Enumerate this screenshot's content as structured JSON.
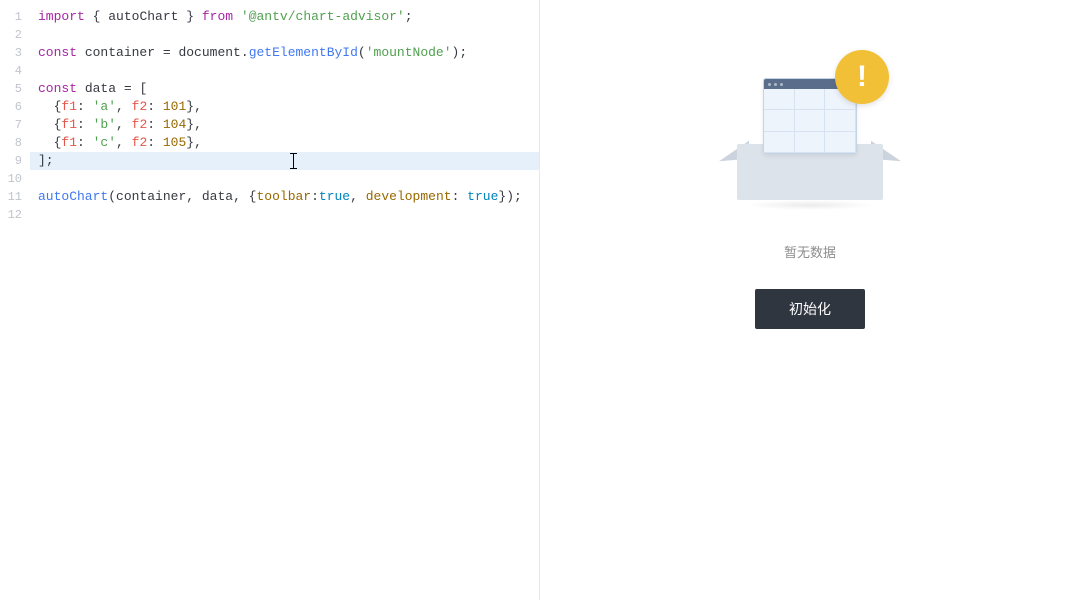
{
  "editor": {
    "highlighted_line_index": 8,
    "cursor": {
      "line": 9,
      "col_approx": 36
    },
    "line_numbers": [
      "1",
      "2",
      "3",
      "4",
      "5",
      "6",
      "7",
      "8",
      "9",
      "10",
      "11",
      "12"
    ],
    "lines": [
      {
        "tokens": [
          {
            "t": "import",
            "c": "kw"
          },
          {
            "t": " ",
            "c": "punc"
          },
          {
            "t": "{ ",
            "c": "punc"
          },
          {
            "t": "autoChart",
            "c": "var"
          },
          {
            "t": " }",
            "c": "punc"
          },
          {
            "t": " ",
            "c": "punc"
          },
          {
            "t": "from",
            "c": "kw"
          },
          {
            "t": " ",
            "c": "punc"
          },
          {
            "t": "'@antv/chart-advisor'",
            "c": "str"
          },
          {
            "t": ";",
            "c": "punc"
          }
        ]
      },
      {
        "tokens": []
      },
      {
        "tokens": [
          {
            "t": "const",
            "c": "kw"
          },
          {
            "t": " ",
            "c": "punc"
          },
          {
            "t": "container",
            "c": "var"
          },
          {
            "t": " = ",
            "c": "punc"
          },
          {
            "t": "document",
            "c": "obj"
          },
          {
            "t": ".",
            "c": "punc"
          },
          {
            "t": "getElementById",
            "c": "fn"
          },
          {
            "t": "(",
            "c": "punc"
          },
          {
            "t": "'mountNode'",
            "c": "str"
          },
          {
            "t": ");",
            "c": "punc"
          }
        ]
      },
      {
        "tokens": []
      },
      {
        "tokens": [
          {
            "t": "const",
            "c": "kw"
          },
          {
            "t": " ",
            "c": "punc"
          },
          {
            "t": "data",
            "c": "var"
          },
          {
            "t": " = [",
            "c": "punc"
          }
        ]
      },
      {
        "tokens": [
          {
            "t": "  {",
            "c": "punc"
          },
          {
            "t": "f1",
            "c": "prop"
          },
          {
            "t": ": ",
            "c": "punc"
          },
          {
            "t": "'a'",
            "c": "str"
          },
          {
            "t": ", ",
            "c": "punc"
          },
          {
            "t": "f2",
            "c": "prop"
          },
          {
            "t": ": ",
            "c": "punc"
          },
          {
            "t": "101",
            "c": "num"
          },
          {
            "t": "},",
            "c": "punc"
          }
        ]
      },
      {
        "tokens": [
          {
            "t": "  {",
            "c": "punc"
          },
          {
            "t": "f1",
            "c": "prop"
          },
          {
            "t": ": ",
            "c": "punc"
          },
          {
            "t": "'b'",
            "c": "str"
          },
          {
            "t": ", ",
            "c": "punc"
          },
          {
            "t": "f2",
            "c": "prop"
          },
          {
            "t": ": ",
            "c": "punc"
          },
          {
            "t": "104",
            "c": "num"
          },
          {
            "t": "},",
            "c": "punc"
          }
        ]
      },
      {
        "tokens": [
          {
            "t": "  {",
            "c": "punc"
          },
          {
            "t": "f1",
            "c": "prop"
          },
          {
            "t": ": ",
            "c": "punc"
          },
          {
            "t": "'c'",
            "c": "str"
          },
          {
            "t": ", ",
            "c": "punc"
          },
          {
            "t": "f2",
            "c": "prop"
          },
          {
            "t": ": ",
            "c": "punc"
          },
          {
            "t": "105",
            "c": "num"
          },
          {
            "t": "},",
            "c": "punc"
          }
        ]
      },
      {
        "tokens": [
          {
            "t": "];",
            "c": "punc"
          }
        ]
      },
      {
        "tokens": []
      },
      {
        "tokens": [
          {
            "t": "autoChart",
            "c": "fn"
          },
          {
            "t": "(",
            "c": "punc"
          },
          {
            "t": "container",
            "c": "var"
          },
          {
            "t": ", ",
            "c": "punc"
          },
          {
            "t": "data",
            "c": "var"
          },
          {
            "t": ", {",
            "c": "punc"
          },
          {
            "t": "toolbar",
            "c": "attr"
          },
          {
            "t": ":",
            "c": "punc"
          },
          {
            "t": "true",
            "c": "bool"
          },
          {
            "t": ", ",
            "c": "punc"
          },
          {
            "t": "development",
            "c": "attr"
          },
          {
            "t": ": ",
            "c": "punc"
          },
          {
            "t": "true",
            "c": "bool"
          },
          {
            "t": "});",
            "c": "punc"
          }
        ]
      },
      {
        "tokens": []
      }
    ]
  },
  "preview": {
    "empty_text": "暂无数据",
    "init_button_label": "初始化"
  }
}
